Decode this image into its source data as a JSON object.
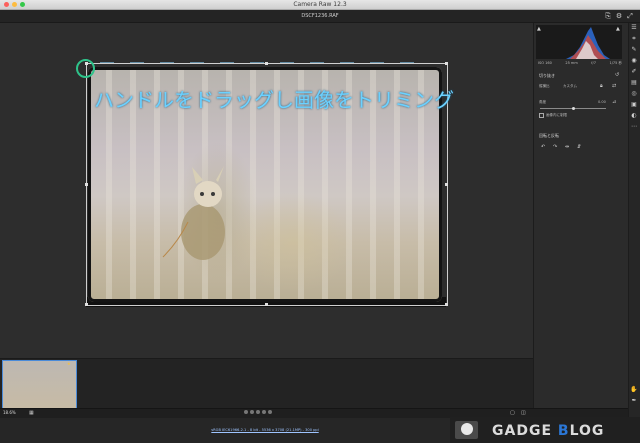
{
  "window": {
    "title": "Camera Raw 12.3"
  },
  "toolbar": {
    "file_name": "DSCF1236.RAF"
  },
  "annotation": {
    "text": "ハンドルをドラッグし画像をトリミング"
  },
  "histogram": {
    "meta": [
      "ISO 160",
      "25 mm",
      "f/7",
      "1/75 秒"
    ],
    "colors": {
      "red": "#d24a3a",
      "blue": "#2f6fd8",
      "white": "#e8e8e8"
    }
  },
  "crop_panel": {
    "title": "切り抜き",
    "aspect_label": "縦横比",
    "aspect_value": "カスタム",
    "angle_label": "角度",
    "angle_value": "0.00",
    "constrain_label": "画像内に制限"
  },
  "rotate_panel": {
    "title": "回転と反転"
  },
  "filmstrip": {
    "zoom": "18.6%"
  },
  "status": {
    "info_link": "sRGB IEC61966-2.1 - 8 bit - 5536 x 3708 (21.1MP) - 300 ppi"
  },
  "watermark": {
    "text_main": "GADGE ",
    "text_accent": "B",
    "text_end": "LOG"
  },
  "colors": {
    "annotation": "#6bd1ff",
    "marker": "#2ec38a",
    "selection": "#4a8ad8"
  }
}
